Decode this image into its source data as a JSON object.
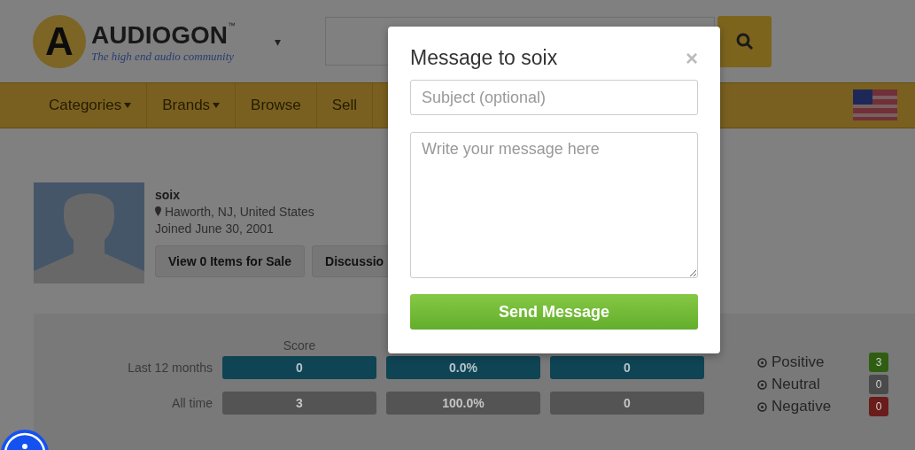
{
  "site": {
    "logo_letter": "A",
    "name": "AUDIOGON",
    "trademark": "™",
    "tagline": "The high end audio community",
    "menu_caret": "▾"
  },
  "nav": {
    "items": [
      {
        "label": "Categories",
        "has_menu": true
      },
      {
        "label": "Brands",
        "has_menu": true
      },
      {
        "label": "Browse",
        "has_menu": false
      },
      {
        "label": "Sell",
        "has_menu": false
      }
    ]
  },
  "profile": {
    "username": "soix",
    "location": "Haworth, NJ, United States",
    "joined": "Joined June 30, 2001",
    "buttons": [
      "View 0 Items for Sale",
      "Discussio"
    ]
  },
  "feedback": {
    "header": "Score",
    "rows": [
      {
        "label": "Last 12 months",
        "kind": "recent",
        "cells": [
          "0",
          "0.0%",
          "0"
        ]
      },
      {
        "label": "All time",
        "kind": "total",
        "cells": [
          "3",
          "100.0%",
          "0"
        ]
      }
    ],
    "legend": [
      {
        "label": "Positive",
        "count": "3",
        "color": "#2f5e12"
      },
      {
        "label": "Neutral",
        "count": "0",
        "color": "#4a4a4a"
      },
      {
        "label": "Negative",
        "count": "0",
        "color": "#6a1c1a"
      }
    ]
  },
  "modal": {
    "title": "Message to soix",
    "close": "×",
    "subject": {
      "placeholder": "Subject (optional)"
    },
    "message": {
      "placeholder": "Write your message here"
    },
    "button": "Send Message"
  }
}
